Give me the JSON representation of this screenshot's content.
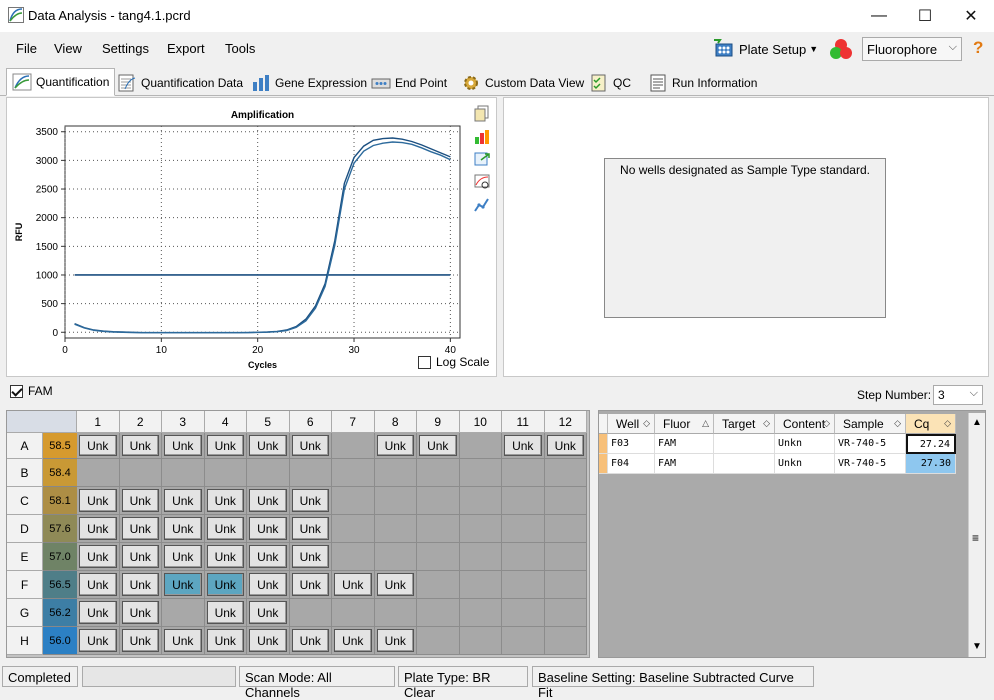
{
  "window": {
    "title": "Data Analysis - tang4.1.pcrd",
    "minimize": "—",
    "maximize": "☐",
    "close": "✕"
  },
  "menu": {
    "file": "File",
    "view": "View",
    "settings": "Settings",
    "export": "Export",
    "tools": "Tools"
  },
  "toolbar": {
    "plate_setup": "Plate Setup",
    "fluorophore": "Fluorophore",
    "help": "?"
  },
  "tabs": [
    {
      "label": "Quantification"
    },
    {
      "label": "Quantification Data"
    },
    {
      "label": "Gene Expression"
    },
    {
      "label": "End Point"
    },
    {
      "label": "Custom Data View"
    },
    {
      "label": "QC"
    },
    {
      "label": "Run Information"
    }
  ],
  "chart_data": {
    "type": "line",
    "title": "Amplification",
    "xlabel": "Cycles",
    "ylabel": "RFU",
    "xlim": [
      0,
      41
    ],
    "ylim": [
      -100,
      3600
    ],
    "xticks": [
      0,
      10,
      20,
      30,
      40
    ],
    "yticks": [
      0,
      500,
      1000,
      1500,
      2000,
      2500,
      3000,
      3500
    ],
    "grid": true,
    "threshold": 1000,
    "series": [
      {
        "x": [
          1,
          2,
          3,
          4,
          5,
          6,
          7,
          8,
          9,
          10,
          11,
          12,
          13,
          14,
          15,
          16,
          17,
          18,
          19,
          20,
          21,
          22,
          23,
          24,
          25,
          26,
          27,
          28,
          29,
          30,
          31,
          32,
          33,
          34,
          35,
          36,
          37,
          38,
          39,
          40
        ],
        "values": [
          150,
          80,
          40,
          20,
          10,
          5,
          0,
          -5,
          -5,
          -5,
          -5,
          -5,
          -5,
          -5,
          -5,
          -5,
          -5,
          -5,
          -5,
          0,
          5,
          15,
          40,
          100,
          230,
          460,
          850,
          1600,
          2600,
          3050,
          3250,
          3350,
          3380,
          3390,
          3370,
          3330,
          3270,
          3200,
          3130,
          3060
        ]
      },
      {
        "x": [
          1,
          2,
          3,
          4,
          5,
          6,
          7,
          8,
          9,
          10,
          11,
          12,
          13,
          14,
          15,
          16,
          17,
          18,
          19,
          20,
          21,
          22,
          23,
          24,
          25,
          26,
          27,
          28,
          29,
          30,
          31,
          32,
          33,
          34,
          35,
          36,
          37,
          38,
          39,
          40
        ],
        "values": [
          140,
          75,
          35,
          15,
          5,
          0,
          -5,
          -8,
          -8,
          -8,
          -8,
          -8,
          -8,
          -8,
          -8,
          -8,
          -8,
          -8,
          -6,
          -3,
          2,
          10,
          30,
          85,
          200,
          420,
          800,
          1520,
          2500,
          2950,
          3160,
          3260,
          3300,
          3320,
          3310,
          3280,
          3220,
          3150,
          3090,
          3010
        ]
      }
    ]
  },
  "log_scale_label": "Log Scale",
  "std_message": "No wells designated as Sample Type standard.",
  "fam_label": "FAM",
  "step_number_label": "Step Number:",
  "step_number_value": "3",
  "plate": {
    "cols": [
      "1",
      "2",
      "3",
      "4",
      "5",
      "6",
      "7",
      "8",
      "9",
      "10",
      "11",
      "12"
    ],
    "rows": [
      {
        "label": "A",
        "temp": "58.5",
        "color": "#d69a2e",
        "wells": [
          "Unk",
          "Unk",
          "Unk",
          "Unk",
          "Unk",
          "Unk",
          "",
          "Unk",
          "Unk",
          "",
          "Unk",
          "Unk"
        ]
      },
      {
        "label": "B",
        "temp": "58.4",
        "color": "#c99935",
        "wells": [
          "",
          "",
          "",
          "",
          "",
          "",
          "",
          "",
          "",
          "",
          "",
          ""
        ]
      },
      {
        "label": "C",
        "temp": "58.1",
        "color": "#ad8e45",
        "wells": [
          "Unk",
          "Unk",
          "Unk",
          "Unk",
          "Unk",
          "Unk",
          "",
          "",
          "",
          "",
          "",
          ""
        ]
      },
      {
        "label": "D",
        "temp": "57.6",
        "color": "#8f8a57",
        "wells": [
          "Unk",
          "Unk",
          "Unk",
          "Unk",
          "Unk",
          "Unk",
          "",
          "",
          "",
          "",
          "",
          ""
        ]
      },
      {
        "label": "E",
        "temp": "57.0",
        "color": "#6f8366",
        "wells": [
          "Unk",
          "Unk",
          "Unk",
          "Unk",
          "Unk",
          "Unk",
          "",
          "",
          "",
          "",
          "",
          ""
        ]
      },
      {
        "label": "F",
        "temp": "56.5",
        "color": "#4f7e88",
        "wells": [
          "Unk",
          "Unk",
          "Unk",
          "Unk",
          "Unk",
          "Unk",
          "Unk",
          "Unk",
          "",
          "",
          "",
          ""
        ]
      },
      {
        "label": "G",
        "temp": "56.2",
        "color": "#3d7ea5",
        "wells": [
          "Unk",
          "Unk",
          "",
          "Unk",
          "Unk",
          "",
          "",
          "",
          "",
          "",
          "",
          ""
        ]
      },
      {
        "label": "H",
        "temp": "56.0",
        "color": "#2c80c4",
        "wells": [
          "Unk",
          "Unk",
          "Unk",
          "Unk",
          "Unk",
          "Unk",
          "Unk",
          "Unk",
          "",
          "",
          "",
          ""
        ]
      }
    ],
    "selected": [
      "F3",
      "F4"
    ]
  },
  "table": {
    "headers": [
      "Well",
      "Fluor",
      "Target",
      "Content",
      "Sample",
      "Cq"
    ],
    "rows": [
      {
        "well": "F03",
        "fluor": "FAM",
        "target": "",
        "content": "Unkn",
        "sample": "VR-740-5",
        "cq": "27.24"
      },
      {
        "well": "F04",
        "fluor": "FAM",
        "target": "",
        "content": "Unkn",
        "sample": "VR-740-5",
        "cq": "27.30"
      }
    ]
  },
  "status": {
    "completed": "Completed",
    "scan_mode": "Scan Mode: All Channels",
    "plate_type": "Plate Type: BR Clear",
    "baseline": "Baseline Setting: Baseline Subtracted Curve Fit"
  }
}
